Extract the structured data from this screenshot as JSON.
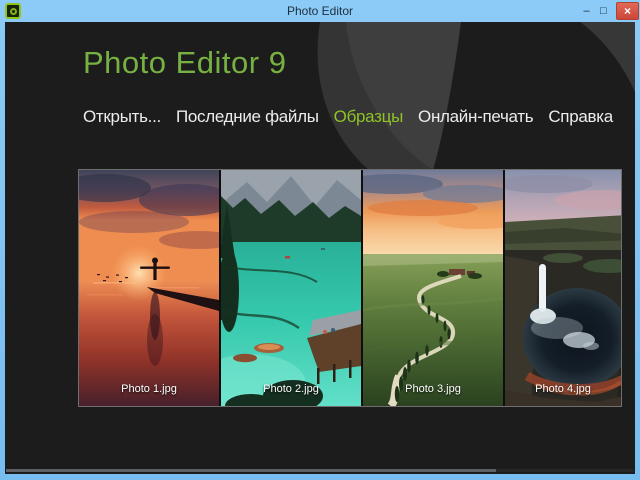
{
  "titlebar": {
    "title": "Photo Editor",
    "icons": {
      "app": "aperture-ring",
      "minimize": "–",
      "maximize": "□",
      "close": "×"
    }
  },
  "header": {
    "app_title": "Photo Editor 9"
  },
  "menu": {
    "items": [
      {
        "label": "Открыть...",
        "active": false
      },
      {
        "label": "Последние файлы",
        "active": false
      },
      {
        "label": "Образцы",
        "active": true
      },
      {
        "label": "Онлайн-печать",
        "active": false
      },
      {
        "label": "Справка",
        "active": false
      }
    ]
  },
  "gallery": {
    "photos": [
      {
        "filename": "Photo 1.jpg",
        "alt": "sunset over sea, silhouetted person with outstretched arms on a jetty"
      },
      {
        "filename": "Photo 2.jpg",
        "alt": "turquoise alpine lake with wooden dock, boats and pine trees"
      },
      {
        "filename": "Photo 3.jpg",
        "alt": "winding cypress-lined road through green hills under a sunset sky"
      },
      {
        "filename": "Photo 4.jpg",
        "alt": "waterfall pouring into a dark canyon pool under a pink sky"
      }
    ]
  },
  "scrollbar": {
    "horizontal_thumb_percent": 78
  },
  "colors": {
    "titlebar_blue": "#7dc1f2",
    "close_red": "#d4564a",
    "background_dark": "#1c1c1c",
    "swoosh_gray": "#3a3a3a",
    "heading_green": "#77b141",
    "active_menu_green": "#8ec525"
  }
}
